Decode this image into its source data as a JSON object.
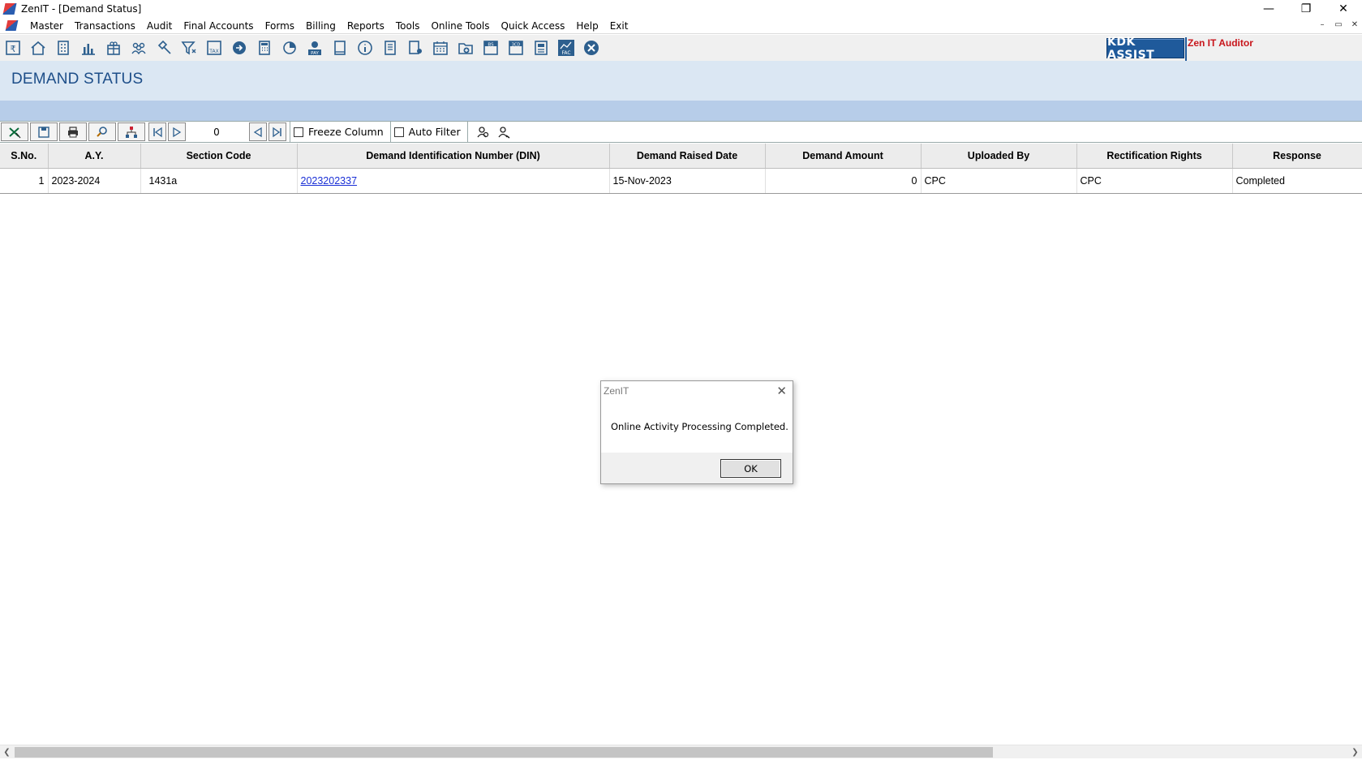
{
  "window": {
    "title": "ZenIT - [Demand Status]",
    "min": "—",
    "restore": "❐",
    "close": "✕"
  },
  "menu": [
    "Master",
    "Transactions",
    "Audit",
    "Final Accounts",
    "Forms",
    "Billing",
    "Reports",
    "Tools",
    "Online Tools",
    "Quick Access",
    "Help",
    "Exit"
  ],
  "mdi": {
    "min": "–",
    "restore": "▭",
    "close": "✕"
  },
  "toolbar": {
    "icons": [
      "rupee-icon",
      "home-icon",
      "building-icon",
      "bar-chart-icon",
      "gift-icon",
      "people-icon",
      "hammer-icon",
      "filter-icon",
      "tax-icon",
      "arrow-circle-icon",
      "calculator-icon",
      "pie-chart-icon",
      "pay-icon",
      "book-icon",
      "info-icon",
      "report-icon",
      "user-doc-icon",
      "calendar-icon",
      "folder-add-icon",
      "bs-icon",
      "3cd-icon",
      "ledger-icon",
      "fac-icon",
      "close-circle-icon"
    ],
    "tax_label": "TAX",
    "pay_label": "PAY",
    "bs_label": "BS",
    "cd_label": "3CD",
    "fac_label": "FAC",
    "kdk_label": "KDK ASSIST",
    "auditor_label": "Zen IT Auditor"
  },
  "header": {
    "title": "DEMAND STATUS"
  },
  "gridbar": {
    "page": "0",
    "freeze_label": "Freeze Column",
    "autofilter_label": "Auto Filter"
  },
  "table": {
    "columns": [
      "S.No.",
      "A.Y.",
      "Section Code",
      "Demand Identification Number (DIN)",
      "Demand Raised Date",
      "Demand Amount",
      "Uploaded By",
      "Rectification Rights",
      "Response"
    ],
    "rows": [
      {
        "sno": "1",
        "ay": "2023-2024",
        "section": "1431a",
        "din": "2023202337",
        "date": "15-Nov-2023",
        "amount": "0",
        "uploaded": "CPC",
        "rights": "CPC",
        "response": "Completed"
      }
    ]
  },
  "scrollbar": {
    "left": "❮",
    "right": "❯"
  },
  "dialog": {
    "title": "ZenIT",
    "close": "✕",
    "message": "Online Activity Processing Completed.",
    "ok_label": "OK"
  },
  "colors": {
    "accent": "#1d4e89",
    "header_band": "#dbe7f3",
    "sub_band": "#b7cde9",
    "kdk": "#1f5a9b",
    "auditor": "#c8151b",
    "link": "#1a2fd6"
  }
}
